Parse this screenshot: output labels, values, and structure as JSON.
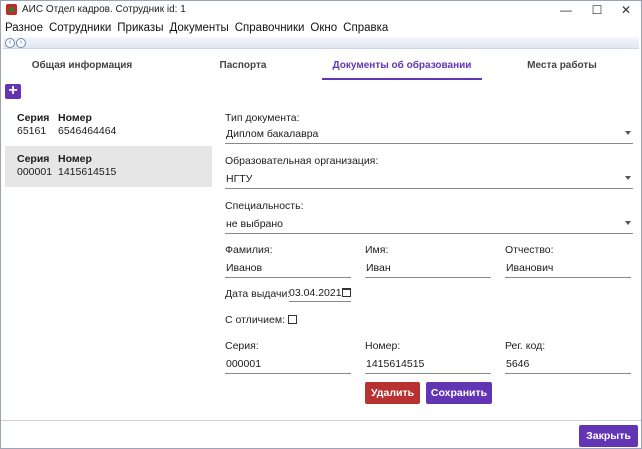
{
  "window": {
    "title": "АИС Отдел кадров. Сотрудник id: 1",
    "controls": [
      "—",
      "☐",
      "✕"
    ]
  },
  "menu": [
    "Разное",
    "Сотрудники",
    "Приказы",
    "Документы",
    "Справочники",
    "Окно",
    "Справка"
  ],
  "tabs": [
    {
      "label": "Общая информация",
      "active": false
    },
    {
      "label": "Паспорта",
      "active": false
    },
    {
      "label": "Документы об образовании",
      "active": true
    },
    {
      "label": "Места работы",
      "active": false
    }
  ],
  "add_button": "+",
  "documents": [
    {
      "series_header": "Серия",
      "number_header": "Номер",
      "series": "65161",
      "number": "6546464464",
      "selected": false
    },
    {
      "series_header": "Серия",
      "number_header": "Номер",
      "series": "000001",
      "number": "1415614515",
      "selected": true
    }
  ],
  "form": {
    "doc_type_label": "Тип документа:",
    "doc_type_value": "Диплом бакалавра",
    "org_label": "Образовательная организация:",
    "org_value": "НГТУ",
    "spec_label": "Специальность:",
    "spec_value": "не выбрано",
    "surname_label": "Фамилия:",
    "surname_value": "Иванов",
    "name_label": "Имя:",
    "name_value": "Иван",
    "patronymic_label": "Отчество:",
    "patronymic_value": "Иванович",
    "issue_date_label": "Дата выдачи:",
    "issue_date_value": "03.04.2021",
    "honors_label": "С отличием:",
    "honors_checked": false,
    "series_label": "Серия:",
    "series_value": "000001",
    "number_label": "Номер:",
    "number_value": "1415614515",
    "reg_label": "Рег. код:",
    "reg_value": "5646"
  },
  "buttons": {
    "delete": "Удалить",
    "save": "Сохранить",
    "close": "Закрыть"
  },
  "colors": {
    "accent": "#6235b4",
    "danger": "#b83232",
    "selected_row": "#e6e6e6"
  }
}
